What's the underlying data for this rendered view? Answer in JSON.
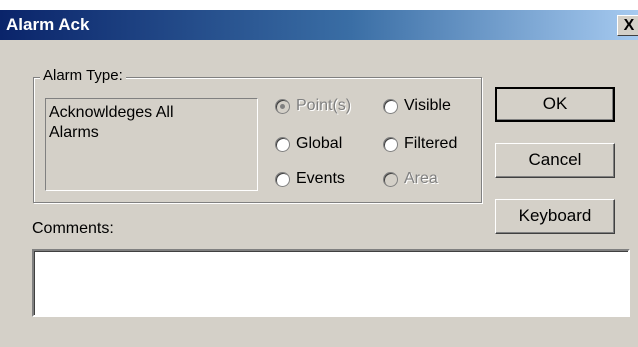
{
  "window": {
    "title": "Alarm Ack",
    "close_glyph": "X"
  },
  "alarm_type": {
    "legend": "Alarm Type:",
    "description": "Acknowldeges All\nAlarms",
    "options": [
      {
        "label": "Point(s)",
        "checked": true,
        "enabled": false
      },
      {
        "label": "Visible",
        "checked": false,
        "enabled": true
      },
      {
        "label": "Global",
        "checked": false,
        "enabled": true
      },
      {
        "label": "Filtered",
        "checked": false,
        "enabled": true
      },
      {
        "label": "Events",
        "checked": false,
        "enabled": true
      },
      {
        "label": "Area",
        "checked": false,
        "enabled": false
      }
    ]
  },
  "buttons": {
    "ok": "OK",
    "cancel": "Cancel",
    "keyboard": "Keyboard"
  },
  "comments": {
    "label": "Comments:",
    "value": ""
  }
}
